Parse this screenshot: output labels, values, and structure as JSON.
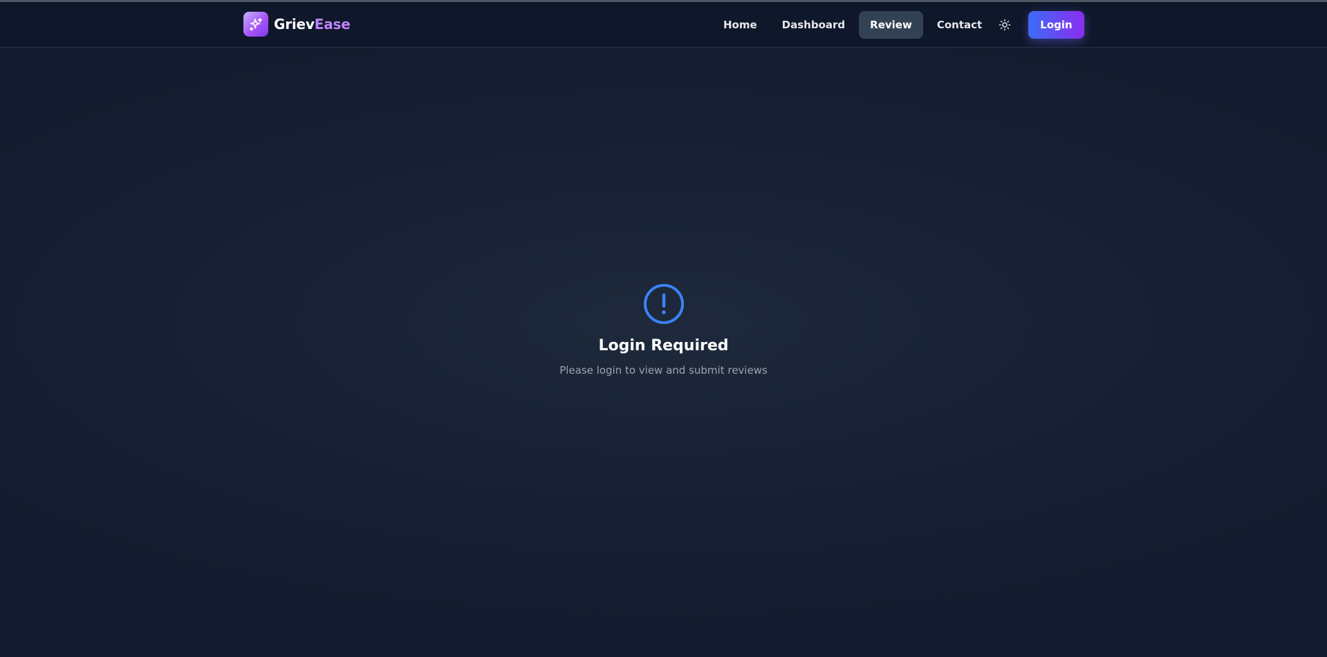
{
  "brand": {
    "name_part1": "Griev",
    "name_part2": "Ease",
    "logo_icon": "sparkles-icon"
  },
  "nav": {
    "items": [
      {
        "label": "Home",
        "active": false
      },
      {
        "label": "Dashboard",
        "active": false
      },
      {
        "label": "Review",
        "active": true
      },
      {
        "label": "Contact",
        "active": false
      }
    ],
    "theme_toggle_icon": "sun-icon",
    "login_label": "Login"
  },
  "main": {
    "icon": "alert-circle-icon",
    "title": "Login Required",
    "subtitle": "Please login to view and submit reviews"
  },
  "colors": {
    "background": "#111a2c",
    "navbar": "#0f172a",
    "accent_blue": "#3b82f6",
    "accent_purple": "#a855f7",
    "brand_highlight": "#c084fc",
    "active_tab": "#334155"
  }
}
